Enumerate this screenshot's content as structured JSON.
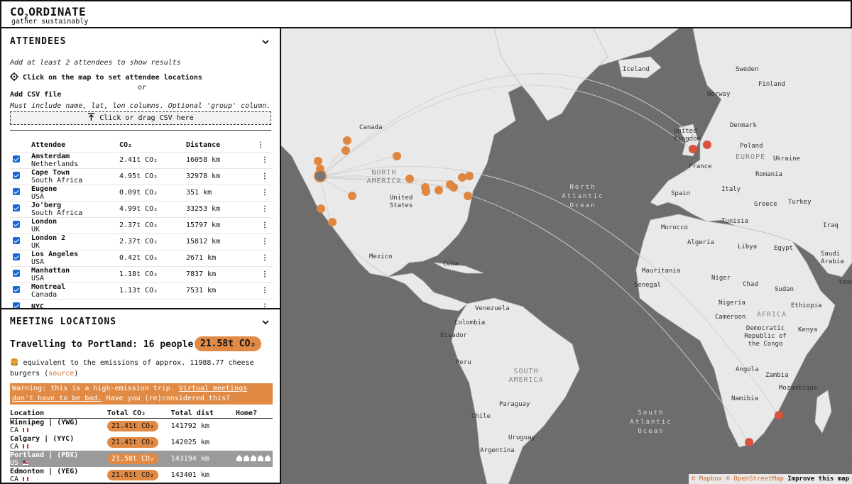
{
  "app": {
    "title_main": "CO",
    "title_sub": "2",
    "title_rest": "ORDINATE",
    "tagline": "gather sustainably"
  },
  "attendees": {
    "header": "ATTENDEES",
    "hint_min": "Add at least 2 attendees to show results",
    "hint_click": "Click on the map to set attendee locations",
    "or": "or",
    "csv_label": "Add CSV file",
    "csv_hint": "Must include name, lat, lon columns. Optional 'group' column.",
    "csv_button": "Click or drag CSV here",
    "columns": [
      "Attendee",
      "CO₂",
      "Distance"
    ],
    "rows": [
      {
        "name": "Amsterdam",
        "country": "Netherlands",
        "co2": "2.41t CO₂",
        "dist": "16058 km"
      },
      {
        "name": "Cape Town",
        "country": "South Africa",
        "co2": "4.95t CO₂",
        "dist": "32978 km"
      },
      {
        "name": "Eugene",
        "country": "USA",
        "co2": "0.09t CO₂",
        "dist": "351 km"
      },
      {
        "name": "Jo'berg",
        "country": "South Africa",
        "co2": "4.99t CO₂",
        "dist": "33253 km"
      },
      {
        "name": "London",
        "country": "UK",
        "co2": "2.37t CO₂",
        "dist": "15797 km"
      },
      {
        "name": "London 2",
        "country": "UK",
        "co2": "2.37t CO₂",
        "dist": "15812 km"
      },
      {
        "name": "Los Angeles",
        "country": "USA",
        "co2": "0.42t CO₂",
        "dist": "2671 km"
      },
      {
        "name": "Manhattan",
        "country": "USA",
        "co2": "1.18t CO₂",
        "dist": "7837 km"
      },
      {
        "name": "Montreal",
        "country": "Canada",
        "co2": "1.13t CO₂",
        "dist": "7531 km"
      },
      {
        "name": "NYC",
        "country": "",
        "co2": "",
        "dist": ""
      }
    ]
  },
  "meeting": {
    "header": "MEETING LOCATIONS",
    "trip_title": "Travelling to Portland: 16 people",
    "trip_co2": "21.58t CO₂",
    "burger_text": "equivalent to the emissions of approx. 11988.77 cheese burgers (",
    "burger_source": "source",
    "burger_close": ")",
    "warning_text": "Warning: this is a high-emission trip. ",
    "warning_link": "Virtual meetings don't have to be bad.",
    "warning_tail": " Have you (re)considered this?",
    "columns": [
      "Location",
      "Total CO₂",
      "Total dist",
      "Home?"
    ],
    "rows": [
      {
        "name": "Winnipeg | (YWG)",
        "country": "CA",
        "flag": "ca",
        "co2": "21.41t CO₂",
        "dist": "141792 km",
        "selected": false
      },
      {
        "name": "Calgary | (YYC)",
        "country": "CA",
        "flag": "ca",
        "co2": "21.41t CO₂",
        "dist": "142025 km",
        "selected": false
      },
      {
        "name": "Portland | (PDX)",
        "country": "US",
        "flag": "us",
        "co2": "21.58t CO₂",
        "dist": "143194 km",
        "selected": true
      },
      {
        "name": "Edmonton | (YEG)",
        "country": "CA",
        "flag": "ca",
        "co2": "21.61t CO₂",
        "dist": "143401 km",
        "selected": false
      }
    ]
  },
  "map": {
    "labels": [
      "Iceland",
      "Sweden",
      "Finland",
      "Norway",
      "Denmark",
      "United Kingdom",
      "Poland",
      "Ukraine",
      "EUROPE",
      "France",
      "Romania",
      "Italy",
      "Spain",
      "Greece",
      "Turkey",
      "Tunisia",
      "Morocco",
      "Algeria",
      "Libya",
      "Egypt",
      "Iraq",
      "Saudi Arabia",
      "Yemen",
      "Mauritania",
      "Niger",
      "Chad",
      "Sudan",
      "Senegal",
      "Nigeria",
      "Ethiopia",
      "Cameroon",
      "AFRICA",
      "Democratic Republic of the Congo",
      "Kenya",
      "Angola",
      "Zambia",
      "Mozambique",
      "Namibia",
      "Canada",
      "NORTH AMERICA",
      "United States",
      "Mexico",
      "Cuba",
      "Venezuela",
      "Colombia",
      "Ecuador",
      "Peru",
      "SOUTH AMERICA",
      "Paraguay",
      "Chile",
      "Uruguay",
      "Argentina",
      "North Atlantic Ocean",
      "South Atlantic Ocean"
    ],
    "attribution_mapbox": "© Mapbox",
    "attribution_osm": "© OpenStreetMap",
    "attribution_improve": "Improve this map"
  },
  "colors": {
    "accent": "#e08a45",
    "marker": "#df8740",
    "home_marker": "#d9533c",
    "land": "#e9e9e9",
    "water": "#6d6d6d"
  }
}
